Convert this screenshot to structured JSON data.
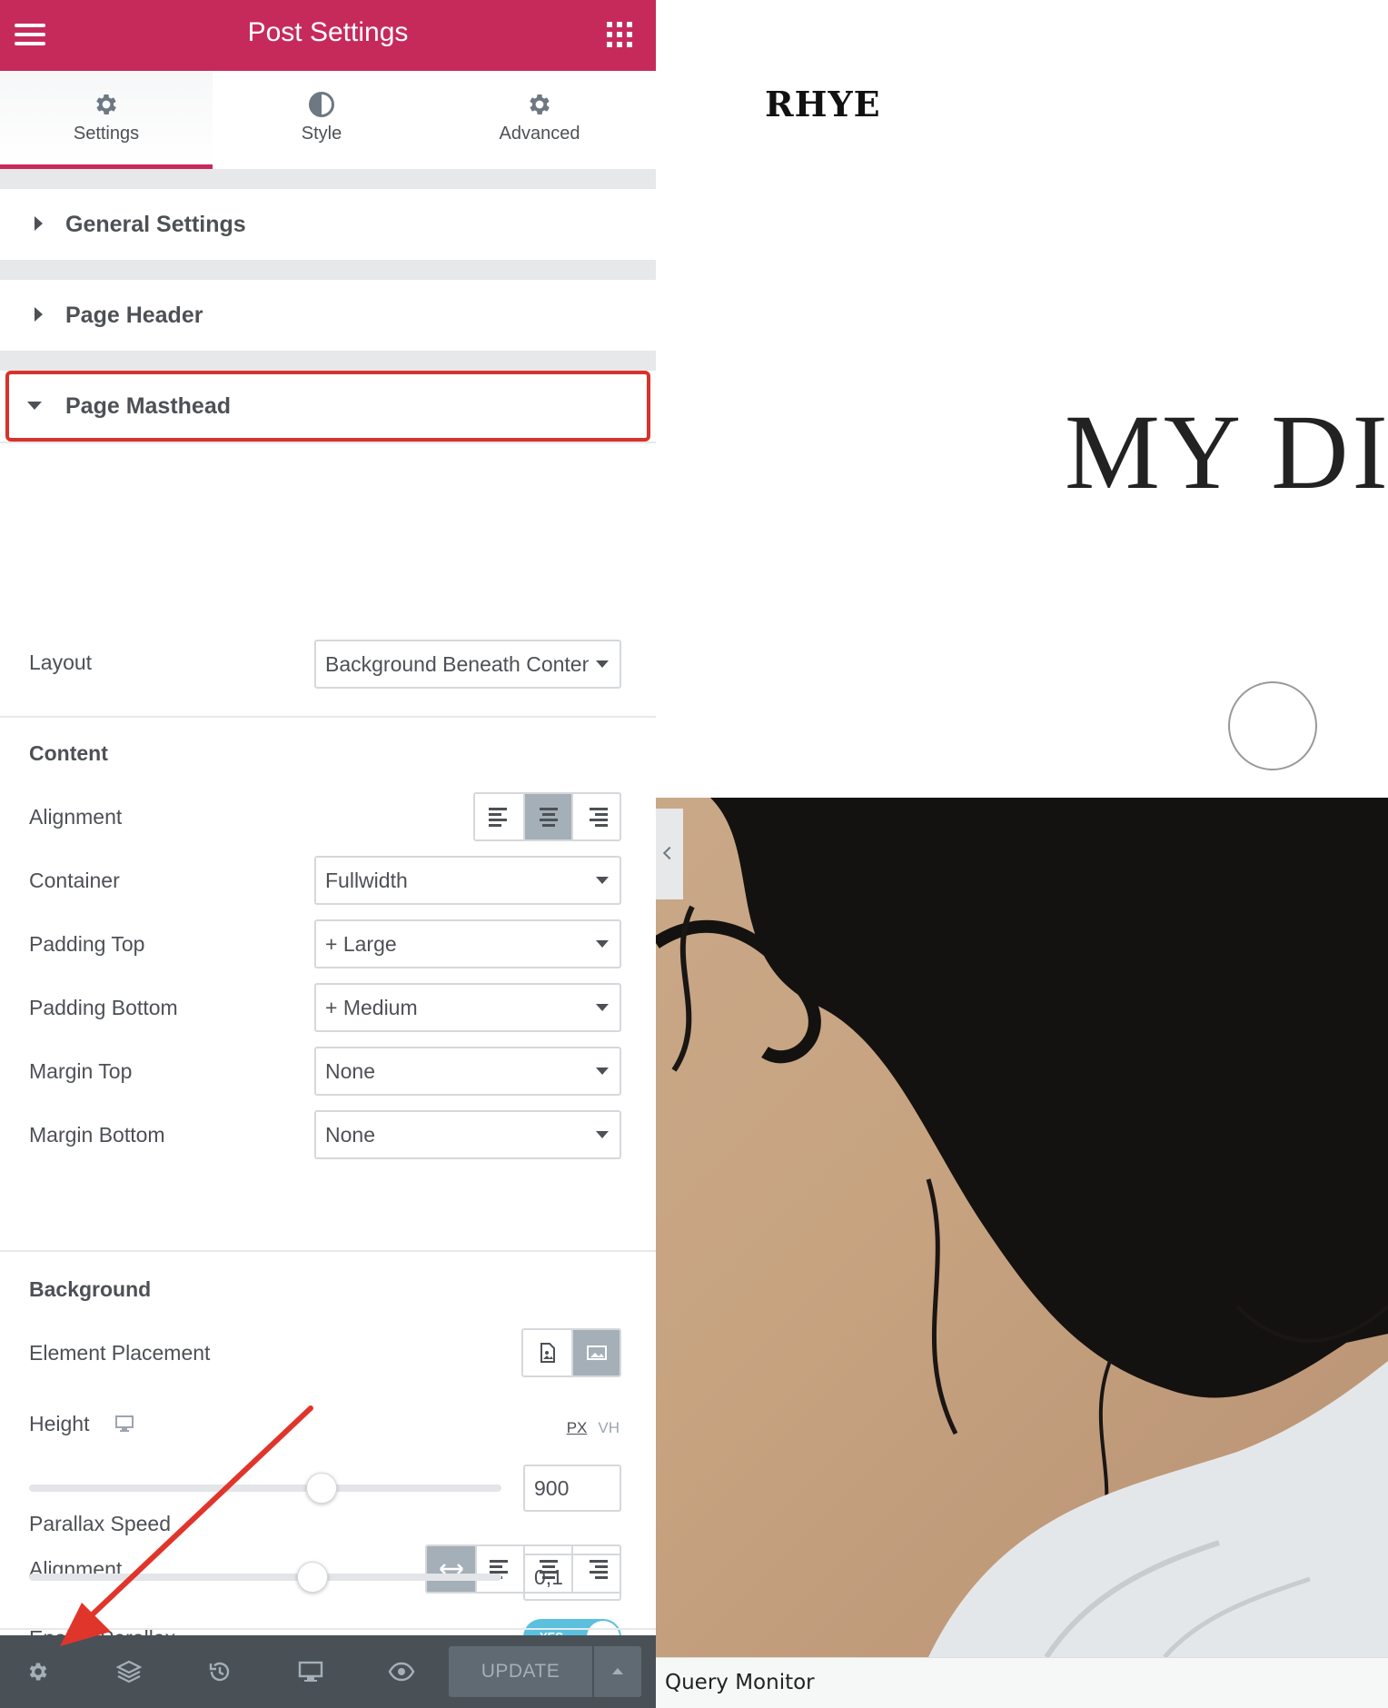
{
  "header": {
    "title": "Post Settings"
  },
  "tabs": [
    {
      "label": "Settings",
      "icon": "gear-icon"
    },
    {
      "label": "Style",
      "icon": "half-circle-icon"
    },
    {
      "label": "Advanced",
      "icon": "gear-icon"
    }
  ],
  "sections": {
    "general": "General Settings",
    "header": "Page Header",
    "masthead": "Page Masthead"
  },
  "controls": {
    "layout": {
      "label": "Layout",
      "value": "Background Beneath Content"
    },
    "content_heading": "Content",
    "alignment": {
      "label": "Alignment",
      "options": [
        "left",
        "center",
        "right"
      ],
      "selected": "center"
    },
    "container": {
      "label": "Container",
      "value": "Fullwidth"
    },
    "padding_top": {
      "label": "Padding Top",
      "value": "+ Large"
    },
    "padding_bottom": {
      "label": "Padding Bottom",
      "value": "+ Medium"
    },
    "margin_top": {
      "label": "Margin Top",
      "value": "None"
    },
    "margin_bottom": {
      "label": "Margin Bottom",
      "value": "None"
    },
    "background_heading": "Background",
    "element_placement": {
      "label": "Element Placement",
      "options": [
        "document-image-icon",
        "image-icon"
      ],
      "selected": "image-icon"
    },
    "height": {
      "label": "Height",
      "unit_px": "PX",
      "unit_vh": "VH",
      "value": "900",
      "slider_fraction": 0.62
    },
    "bg_alignment": {
      "label": "Alignment",
      "options": [
        "stretch",
        "left",
        "center",
        "right"
      ],
      "selected": "stretch"
    },
    "enable_parallax": {
      "label": "Enable Parallax",
      "toggle_text": "YES",
      "on": true
    },
    "parallax_speed": {
      "label": "Parallax Speed",
      "value": "0,1",
      "slider_fraction": 0.6
    }
  },
  "bottombar": {
    "update_label": "UPDATE"
  },
  "preview": {
    "logo": "RHYE",
    "hero_title": "MY DIG",
    "query_monitor": "Query Monitor"
  },
  "colors": {
    "brand": "#c62a5b",
    "annotation": "#d7322c",
    "toggle_on": "#5bc0de",
    "toolbar": "#495157"
  }
}
